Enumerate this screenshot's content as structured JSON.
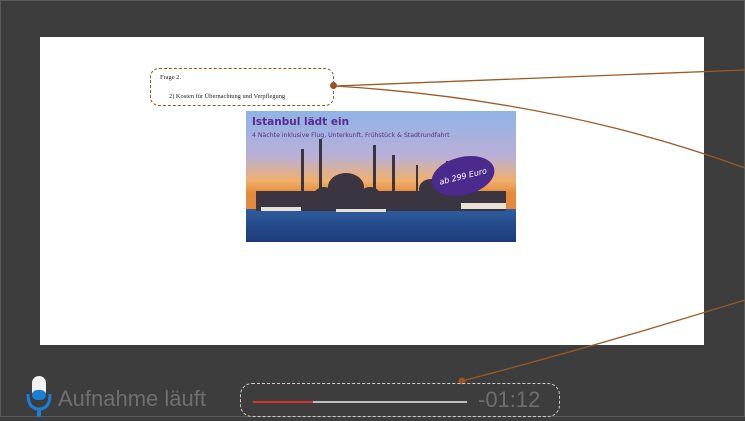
{
  "question": {
    "title": "Frage 2.",
    "text": "2) Kosten für Übernachtung und Verpflegung"
  },
  "ad": {
    "title": "Istanbul  lädt ein",
    "subtitle": "4 Nächte inklusive Flug, Unterkunft, Frühstück & Stadtrundfahrt",
    "badge": "ab 299 Euro"
  },
  "recording": {
    "status": "Aufnahme läuft",
    "time_remaining": "-01:12",
    "progress_fraction": 0.28
  },
  "colors": {
    "background": "#3d3d3d",
    "progress": "#d9342b",
    "annotation": "#a0521e",
    "mic_accent": "#1a7fd6"
  }
}
